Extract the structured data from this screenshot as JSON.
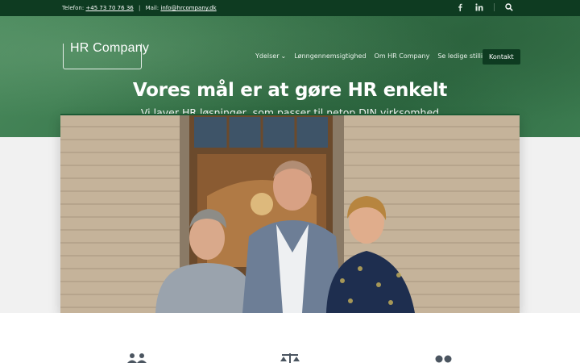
{
  "topbar": {
    "phone_label": "Telefon:",
    "phone": "+45 73 70 76 36",
    "mail_label": "Mail:",
    "mail": "info@hrcompany.dk",
    "social": [
      "facebook-icon",
      "linkedin-icon"
    ]
  },
  "brand": {
    "logo_text": "HR Company"
  },
  "nav": {
    "items": [
      "Ydelser",
      "Lønngennemsigtighed",
      "Om HR Company",
      "Se ledige stillinger"
    ],
    "cta": "Kontakt"
  },
  "hero": {
    "title": "Vores mål er at gøre HR enkelt",
    "subtitle": "Vi laver HR løsninger, som passer til netop DIN virksomhed"
  },
  "colors": {
    "dark_green": "#0e3b21",
    "hero_green": "#3b7a4e"
  },
  "icons": [
    "people-icon",
    "scale-icon",
    "dots-icon"
  ]
}
